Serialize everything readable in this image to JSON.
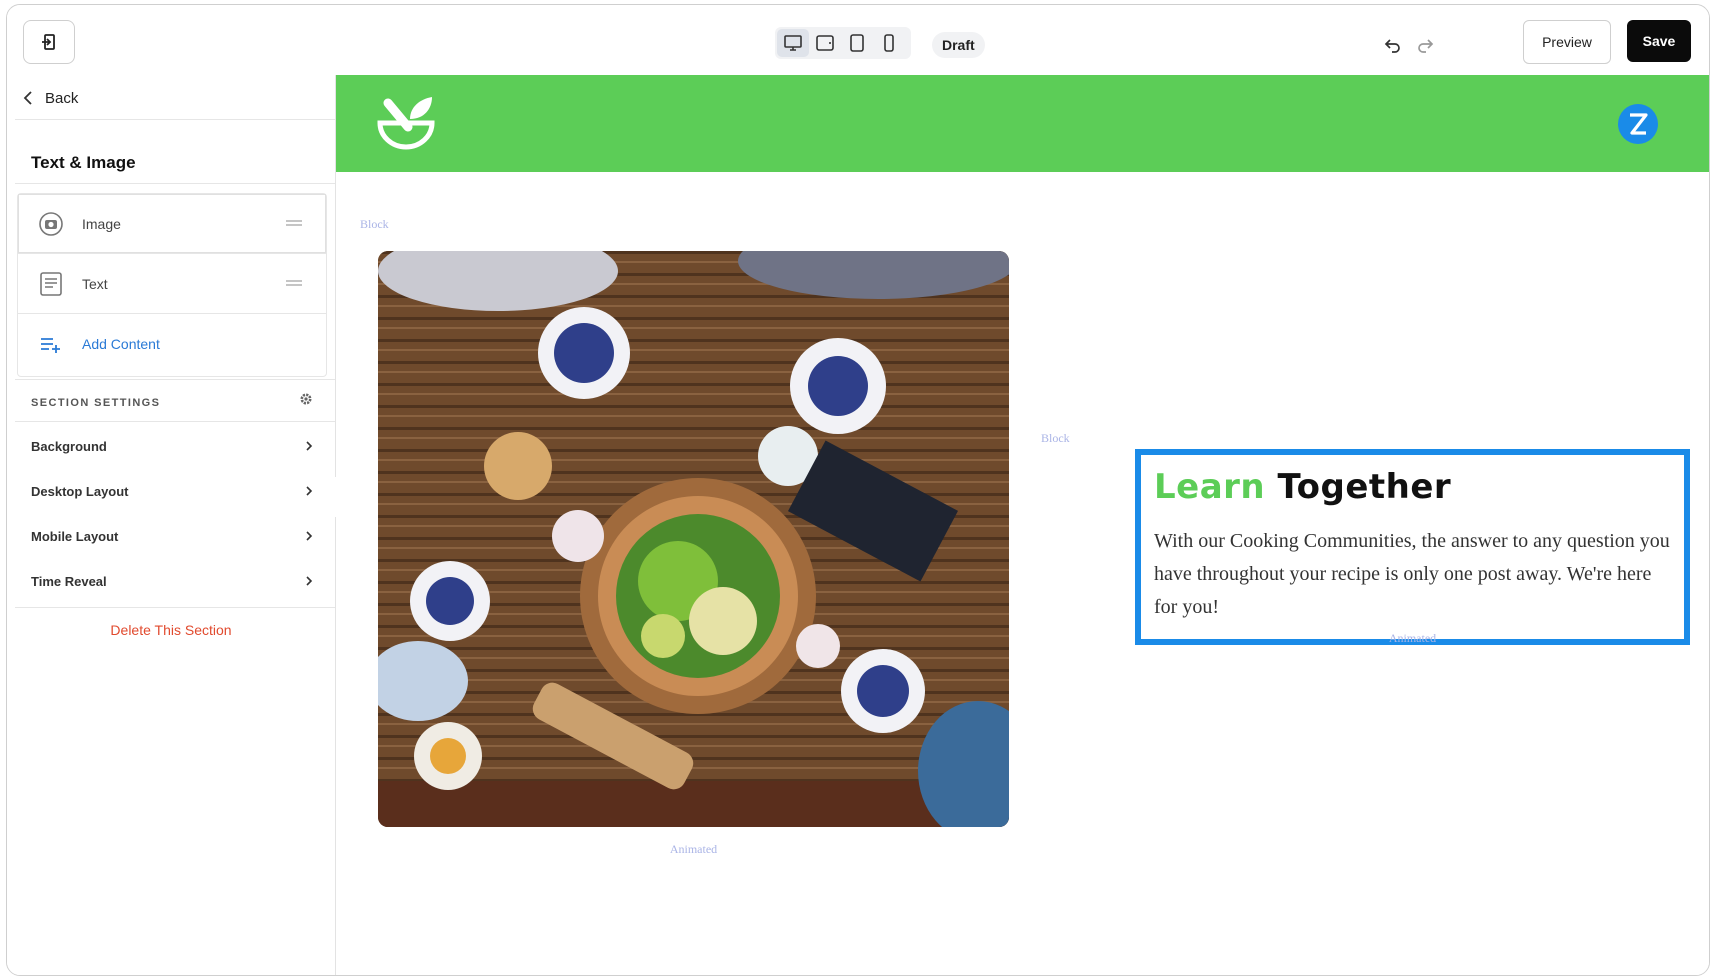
{
  "topbar": {
    "draft_label": "Draft",
    "preview_label": "Preview",
    "save_label": "Save",
    "devices": [
      "desktop-icon",
      "tablet-landscape-icon",
      "tablet-portrait-icon",
      "mobile-icon"
    ],
    "active_device": "desktop"
  },
  "sidebar": {
    "back_label": "Back",
    "title": "Text & Image",
    "content_items": [
      {
        "label": "Image",
        "icon": "camera-icon"
      },
      {
        "label": "Text",
        "icon": "text-document-icon"
      },
      {
        "label": "Add Content",
        "icon": "add-list-icon"
      }
    ],
    "section_settings_label": "SECTION SETTINGS",
    "settings": [
      {
        "label": "Background"
      },
      {
        "label": "Desktop Layout"
      },
      {
        "label": "Mobile Layout"
      },
      {
        "label": "Time Reveal"
      }
    ],
    "delete_label": "Delete This Section"
  },
  "canvas": {
    "header_color": "#5ccd57",
    "block_label": "Block",
    "animated_label": "Animated",
    "heading_accent": "Learn",
    "heading_rest": "Together",
    "body": "With our Cooking Communities, the answer to any question you have throughout your recipe is only one post away. We're here for you!",
    "accent_color": "#5ccd57",
    "selection_color": "#1a8be8"
  }
}
